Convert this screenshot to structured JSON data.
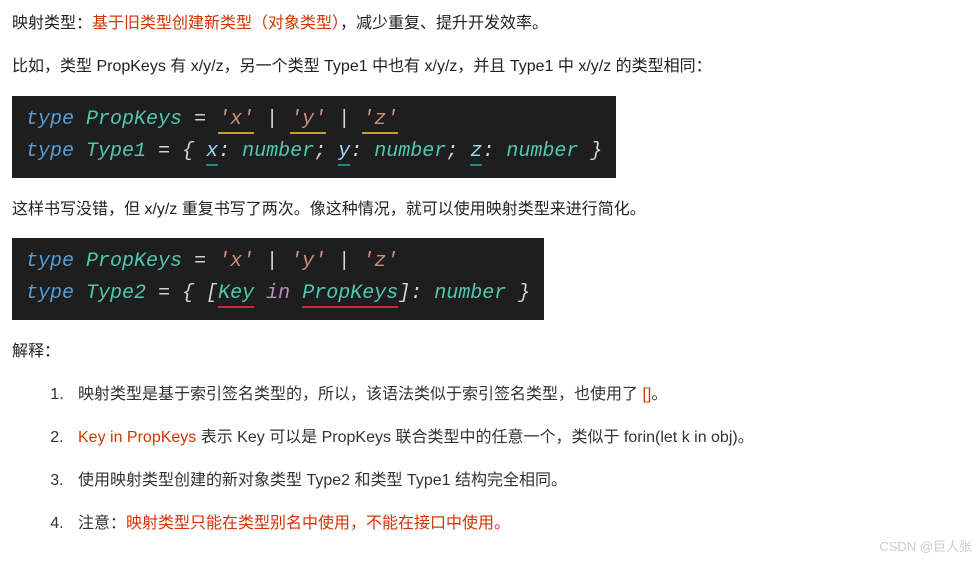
{
  "line1": {
    "pre": "映射类型：",
    "red": "基于旧类型创建新类型（对象类型）",
    "post": "，减少重复、提升开发效率。"
  },
  "line2": "比如，类型 PropKeys 有 x/y/z，另一个类型 Type1 中也有 x/y/z，并且 Type1 中 x/y/z 的类型相同：",
  "code1": {
    "t_type1": "type",
    "t_type2": "type",
    "PropKeys": "PropKeys",
    "Type1": "Type1",
    "eq": "=",
    "sx": "'x'",
    "sy": "'y'",
    "sz": "'z'",
    "pipe": "|",
    "lb": "{",
    "rb": "}",
    "px": "x",
    "py": "y",
    "pz": "z",
    "colon": ":",
    "semi": ";",
    "number": "number"
  },
  "line3": "这样书写没错，但 x/y/z 重复书写了两次。像这种情况，就可以使用映射类型来进行简化。",
  "code2": {
    "t_type1": "type",
    "t_type2": "type",
    "PropKeys": "PropKeys",
    "Type2": "Type2",
    "eq": "=",
    "sx": "'x'",
    "sy": "'y'",
    "sz": "'z'",
    "pipe": "|",
    "lb": "{",
    "rb": "}",
    "lbr": "[",
    "rbr": "]",
    "Key": "Key",
    "in": "in",
    "colon": ":",
    "number": "number"
  },
  "line4": "解释：",
  "list": {
    "i1_a": "映射类型是基于索引签名类型的，所以，该语法类似于索引签名类型，也使用了 ",
    "i1_b": "[]",
    "i1_c": "。",
    "i2_a": "Key in PropKeys",
    "i2_b": " 表示 Key 可以是 PropKeys 联合类型中的任意一个，类似于 forin(let k in obj)。",
    "i3": "使用映射类型创建的新对象类型 Type2 和类型 Type1 结构完全相同。",
    "i4_a": "注意：",
    "i4_b": "映射类型只能在类型别名中使用，不能在接口中使用。"
  },
  "watermark": "CSDN @巨人张"
}
